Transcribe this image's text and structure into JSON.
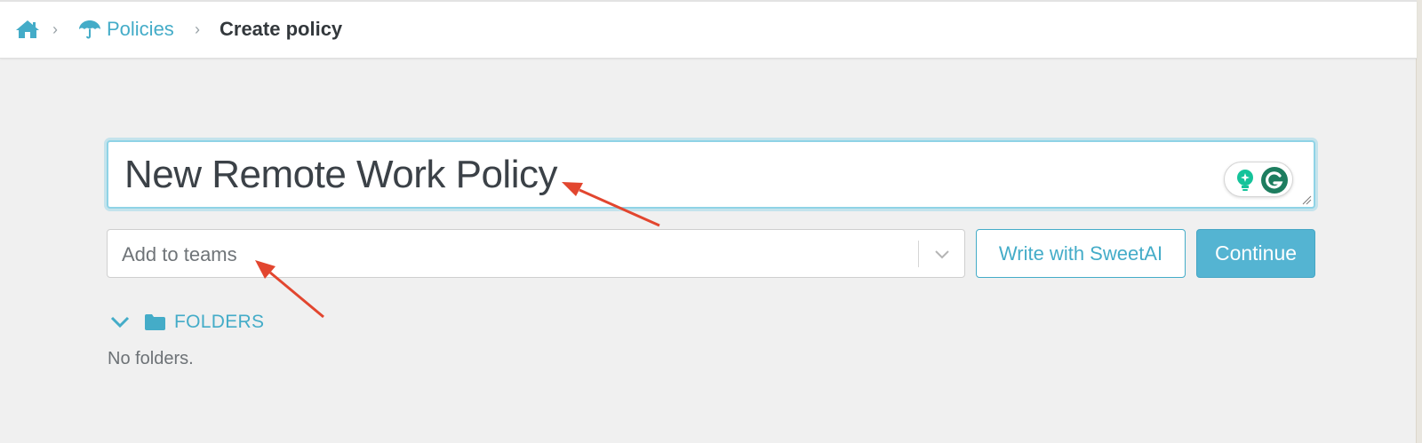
{
  "breadcrumb": {
    "home_icon": "home-icon",
    "separator": "›",
    "policies_label": "Policies",
    "policies_icon": "umbrella-icon",
    "current_label": "Create policy"
  },
  "form": {
    "title_value": "New Remote Work Policy",
    "teams_placeholder": "Add to teams",
    "write_button_label": "Write with SweetAI",
    "continue_button_label": "Continue"
  },
  "folders": {
    "label": "FOLDERS",
    "empty_text": "No folders."
  },
  "colors": {
    "accent": "#44acc8",
    "button_primary": "#54b4d2",
    "annotation_arrow": "#e2462f",
    "grammarly_green": "#15c39a"
  }
}
